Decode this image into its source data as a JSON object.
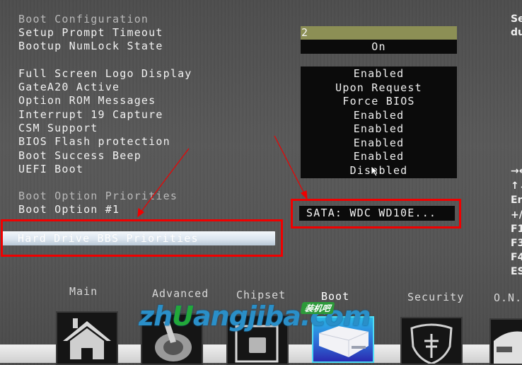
{
  "boot_configuration": {
    "section_header": "Boot Configuration",
    "settings": [
      {
        "label": "Setup Prompt Timeout",
        "value": "2"
      },
      {
        "label": "Bootup NumLock State",
        "value": "On"
      },
      {
        "label": "Full Screen Logo Display",
        "value": "Enabled"
      },
      {
        "label": "GateA20 Active",
        "value": "Upon Request"
      },
      {
        "label": "Option ROM Messages",
        "value": "Force BIOS"
      },
      {
        "label": "Interrupt 19 Capture",
        "value": "Enabled"
      },
      {
        "label": "CSM Support",
        "value": "Enabled"
      },
      {
        "label": "BIOS Flash protection",
        "value": "Enabled"
      },
      {
        "label": "Boot Success Beep",
        "value": "Enabled"
      },
      {
        "label": "UEFI Boot",
        "value": "Disabled"
      }
    ]
  },
  "boot_option_priorities": {
    "section_header": "Boot Option Priorities",
    "boot_option_1": {
      "label": "Boot Option #1",
      "value": "SATA: WDC WD10E..."
    },
    "hard_drive_bbs": "Hard Drive BBS Priorities"
  },
  "help_panel": {
    "description_lines": [
      "Se",
      "du"
    ],
    "key_hints": [
      "→←",
      "↑↓",
      "En",
      "+/",
      "F1",
      "F3",
      "F4",
      "ES"
    ]
  },
  "tabs": [
    {
      "label": "Main",
      "icon": "home-icon",
      "active": false
    },
    {
      "label": "Advanced",
      "icon": "joystick-icon",
      "active": false
    },
    {
      "label": "Chipset",
      "icon": "chip-icon",
      "active": false
    },
    {
      "label": "Boot",
      "icon": "drive-icon",
      "active": true
    },
    {
      "label": "Security",
      "icon": "shield-icon",
      "active": false
    },
    {
      "label": "O.N.",
      "icon": "gauge-icon",
      "active": false
    }
  ],
  "watermark": {
    "text_prefix": "zh",
    "text_u": "U",
    "text_suffix": "angjiba.com",
    "badge": "装机吧"
  },
  "colors": {
    "annotation_red": "#f00000",
    "timeout_highlight": "#8c8f55",
    "active_tab": "#2f6fd8"
  }
}
